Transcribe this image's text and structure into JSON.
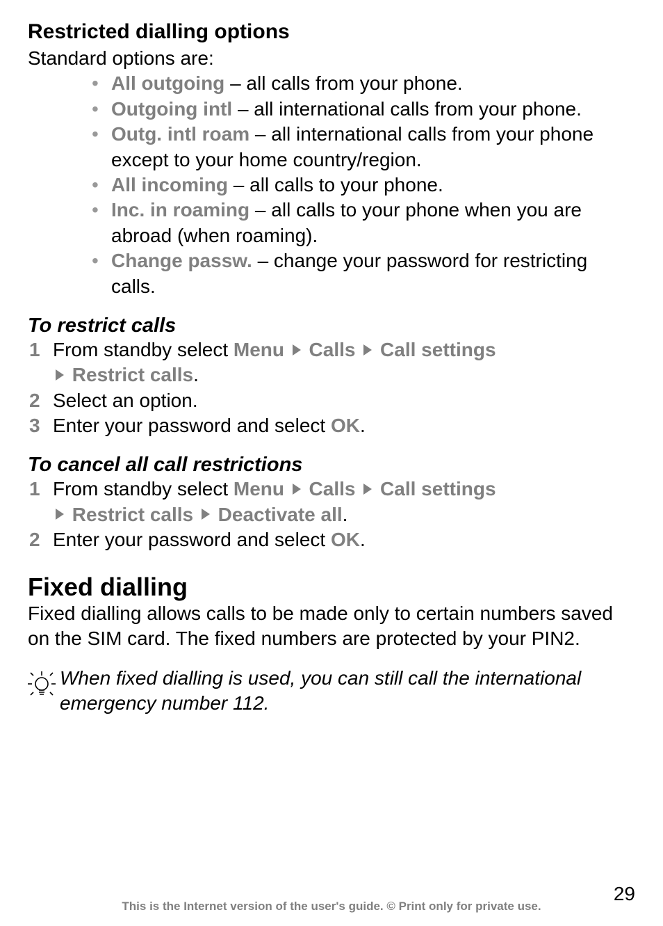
{
  "section1": {
    "title": "Restricted dialling options",
    "intro": "Standard options are:",
    "bullets": [
      {
        "label": "All outgoing",
        "desc": " – all calls from your phone."
      },
      {
        "label": "Outgoing intl",
        "desc": " – all international calls from your phone."
      },
      {
        "label": "Outg. intl roam",
        "desc": " – all international calls from your phone except to your home country/region."
      },
      {
        "label": "All incoming",
        "desc": " – all calls to your phone."
      },
      {
        "label": "Inc. in roaming",
        "desc": " – all calls to your phone when you are abroad (when roaming)."
      },
      {
        "label": "Change passw.",
        "desc": " – change your password for restricting calls."
      }
    ]
  },
  "section2": {
    "title": "To restrict calls",
    "steps": [
      {
        "prefix": "From standby select ",
        "path": [
          "Menu",
          "Calls",
          "Call settings",
          "Restrict calls"
        ],
        "suffix": "."
      },
      {
        "plain": "Select an option."
      },
      {
        "prefix": "Enter your password and select ",
        "path": [
          "OK"
        ],
        "suffix": "."
      }
    ]
  },
  "section3": {
    "title": "To cancel all call restrictions",
    "steps": [
      {
        "prefix": "From standby select ",
        "path": [
          "Menu",
          "Calls",
          "Call settings",
          "Restrict calls",
          "Deactivate all"
        ],
        "suffix": "."
      },
      {
        "prefix": "Enter your password and select ",
        "path": [
          "OK"
        ],
        "suffix": "."
      }
    ]
  },
  "section4": {
    "title": "Fixed dialling",
    "body": "Fixed dialling allows calls to be made only to certain numbers saved on the SIM card. The fixed numbers are protected by your PIN2.",
    "tip": "When fixed dialling is used, you can still call the international emergency number 112."
  },
  "footer": {
    "text": "This is the Internet version of the user's guide. © Print only for private use.",
    "page": "29"
  }
}
